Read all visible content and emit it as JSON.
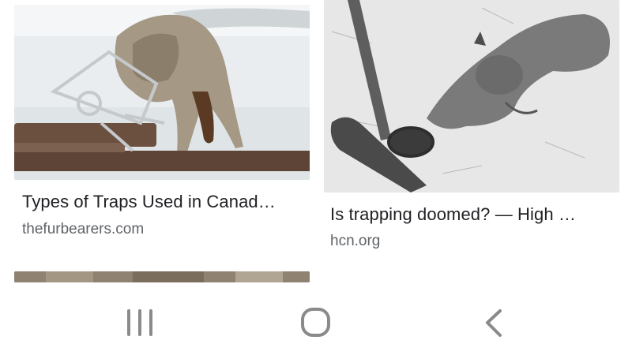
{
  "results": [
    {
      "title": "Types of Traps Used in Canad…",
      "source": "thefurbearers.com",
      "image": "coyote-caught-in-leghold-trap"
    },
    {
      "title": "Is trapping doomed? — High …",
      "source": "hcn.org",
      "image": "lynx-caught-in-trap-in-snow"
    },
    {
      "title": "",
      "source": "",
      "image": "partially-visible-thumbnail"
    }
  ],
  "navbar": {
    "recents_icon": "recent-apps-icon",
    "home_icon": "home-icon",
    "back_icon": "back-icon"
  },
  "colors": {
    "title": "#202124",
    "source": "#5f6368",
    "nav_icon": "#8a8a8a"
  }
}
